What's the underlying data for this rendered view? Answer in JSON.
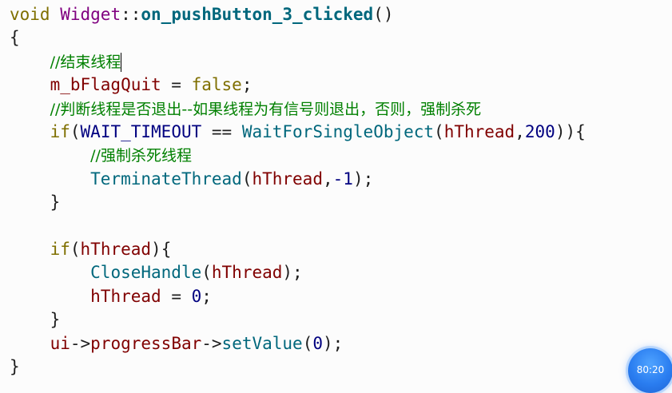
{
  "editor": {
    "lines": [
      [
        {
          "text": "void",
          "kind": "kw"
        },
        {
          "text": " ",
          "kind": "op"
        },
        {
          "text": "Widget",
          "kind": "cls"
        },
        {
          "text": "::",
          "kind": "op"
        },
        {
          "text": "on_pushButton_3_clicked",
          "kind": "fn"
        },
        {
          "text": "()",
          "kind": "op"
        }
      ],
      [
        {
          "text": "{",
          "kind": "op"
        }
      ],
      [
        {
          "text": "    ",
          "kind": "op"
        },
        {
          "text": "//结束线程",
          "kind": "cmt"
        },
        {
          "text": "",
          "kind": "caret"
        }
      ],
      [
        {
          "text": "    ",
          "kind": "op"
        },
        {
          "text": "m_bFlagQuit",
          "kind": "var"
        },
        {
          "text": " = ",
          "kind": "op"
        },
        {
          "text": "false",
          "kind": "kw"
        },
        {
          "text": ";",
          "kind": "op"
        }
      ],
      [
        {
          "text": "    ",
          "kind": "op"
        },
        {
          "text": "//判断线程是否退出--如果线程为有信号则退出，否则，强制杀死",
          "kind": "cmt"
        }
      ],
      [
        {
          "text": "    ",
          "kind": "op"
        },
        {
          "text": "if",
          "kind": "kw"
        },
        {
          "text": "(",
          "kind": "op"
        },
        {
          "text": "WAIT_TIMEOUT",
          "kind": "mac"
        },
        {
          "text": " == ",
          "kind": "op"
        },
        {
          "text": "WaitForSingleObject",
          "kind": "call"
        },
        {
          "text": "(",
          "kind": "op"
        },
        {
          "text": "hThread",
          "kind": "var"
        },
        {
          "text": ",",
          "kind": "op"
        },
        {
          "text": "200",
          "kind": "num"
        },
        {
          "text": ")){",
          "kind": "op"
        }
      ],
      [
        {
          "text": "        ",
          "kind": "op"
        },
        {
          "text": "//强制杀死线程",
          "kind": "cmt"
        }
      ],
      [
        {
          "text": "        ",
          "kind": "op"
        },
        {
          "text": "TerminateThread",
          "kind": "call"
        },
        {
          "text": "(",
          "kind": "op"
        },
        {
          "text": "hThread",
          "kind": "var"
        },
        {
          "text": ",",
          "kind": "op"
        },
        {
          "text": "-1",
          "kind": "num"
        },
        {
          "text": ");",
          "kind": "op"
        }
      ],
      [
        {
          "text": "    ",
          "kind": "op"
        },
        {
          "text": "}",
          "kind": "op"
        }
      ],
      [],
      [
        {
          "text": "    ",
          "kind": "op"
        },
        {
          "text": "if",
          "kind": "kw"
        },
        {
          "text": "(",
          "kind": "op"
        },
        {
          "text": "hThread",
          "kind": "var"
        },
        {
          "text": "){",
          "kind": "op"
        }
      ],
      [
        {
          "text": "        ",
          "kind": "op"
        },
        {
          "text": "CloseHandle",
          "kind": "call"
        },
        {
          "text": "(",
          "kind": "op"
        },
        {
          "text": "hThread",
          "kind": "var"
        },
        {
          "text": ");",
          "kind": "op"
        }
      ],
      [
        {
          "text": "        ",
          "kind": "op"
        },
        {
          "text": "hThread",
          "kind": "var"
        },
        {
          "text": " = ",
          "kind": "op"
        },
        {
          "text": "0",
          "kind": "num"
        },
        {
          "text": ";",
          "kind": "op"
        }
      ],
      [
        {
          "text": "    ",
          "kind": "op"
        },
        {
          "text": "}",
          "kind": "op"
        }
      ],
      [
        {
          "text": "    ",
          "kind": "op"
        },
        {
          "text": "ui",
          "kind": "var"
        },
        {
          "text": "->",
          "kind": "op"
        },
        {
          "text": "progressBar",
          "kind": "var"
        },
        {
          "text": "->",
          "kind": "op"
        },
        {
          "text": "setValue",
          "kind": "call"
        },
        {
          "text": "(",
          "kind": "op"
        },
        {
          "text": "0",
          "kind": "num"
        },
        {
          "text": ");",
          "kind": "op"
        }
      ],
      [
        {
          "text": "}",
          "kind": "op"
        }
      ]
    ],
    "colors": {
      "keyword": "#7f6f00",
      "class": "#800080",
      "function_def": "#00677c",
      "variable": "#800000",
      "comment": "#008000",
      "number": "#000080"
    }
  },
  "badge": {
    "text": "80:20",
    "icon": "timer-badge-icon"
  }
}
